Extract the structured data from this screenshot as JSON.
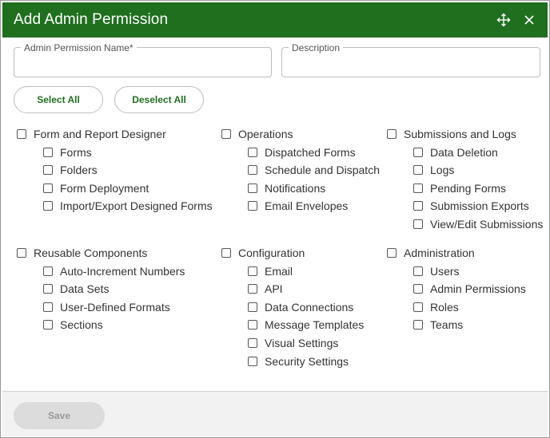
{
  "dialog": {
    "title": "Add Admin Permission",
    "move_icon": "move-arrows-icon",
    "close_icon": "close-icon"
  },
  "fields": {
    "name_label": "Admin Permission Name*",
    "name_value": "",
    "description_label": "Description",
    "description_value": ""
  },
  "buttons": {
    "select_all": "Select All",
    "deselect_all": "Deselect All",
    "save": "Save"
  },
  "colors": {
    "header": "#1f6f1f",
    "accent_text": "#1f6f1f"
  },
  "groups": [
    {
      "label": "Form and Report Designer",
      "items": [
        "Forms",
        "Folders",
        "Form Deployment",
        "Import/Export Designed Forms"
      ]
    },
    {
      "label": "Operations",
      "items": [
        "Dispatched Forms",
        "Schedule and Dispatch",
        "Notifications",
        "Email Envelopes"
      ]
    },
    {
      "label": "Submissions and Logs",
      "items": [
        "Data Deletion",
        "Logs",
        "Pending Forms",
        "Submission Exports",
        "View/Edit Submissions"
      ]
    },
    {
      "label": "Reusable Components",
      "items": [
        "Auto-Increment Numbers",
        "Data Sets",
        "User-Defined Formats",
        "Sections"
      ]
    },
    {
      "label": "Configuration",
      "items": [
        "Email",
        "API",
        "Data Connections",
        "Message Templates",
        "Visual Settings",
        "Security Settings"
      ]
    },
    {
      "label": "Administration",
      "items": [
        "Users",
        "Admin Permissions",
        "Roles",
        "Teams"
      ]
    }
  ]
}
